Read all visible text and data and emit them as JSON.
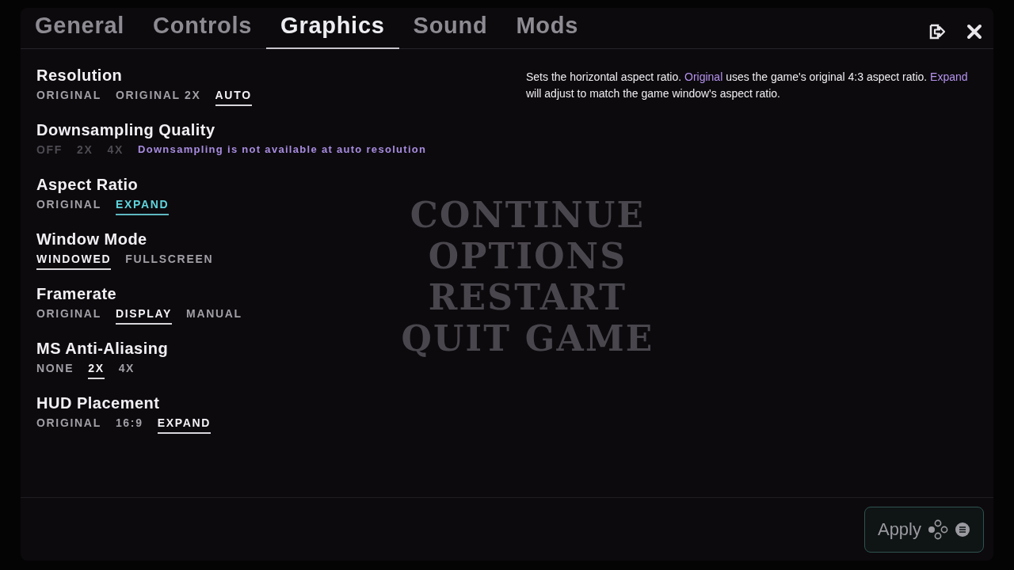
{
  "tabs": [
    {
      "label": "General",
      "selected": false
    },
    {
      "label": "Controls",
      "selected": false
    },
    {
      "label": "Graphics",
      "selected": true
    },
    {
      "label": "Sound",
      "selected": false
    },
    {
      "label": "Mods",
      "selected": false
    }
  ],
  "background_menu": [
    "CONTINUE",
    "OPTIONS",
    "RESTART",
    "QUIT GAME"
  ],
  "settings": [
    {
      "title": "Resolution",
      "disabled": false,
      "options": [
        {
          "label": "ORIGINAL",
          "selected": false,
          "highlighted": false
        },
        {
          "label": "ORIGINAL 2X",
          "selected": false,
          "highlighted": false
        },
        {
          "label": "AUTO",
          "selected": true,
          "highlighted": false
        }
      ]
    },
    {
      "title": "Downsampling Quality",
      "disabled": true,
      "note": "Downsampling is not available at auto resolution",
      "options": [
        {
          "label": "OFF",
          "selected": false,
          "highlighted": false
        },
        {
          "label": "2X",
          "selected": false,
          "highlighted": false
        },
        {
          "label": "4X",
          "selected": false,
          "highlighted": false
        }
      ]
    },
    {
      "title": "Aspect Ratio",
      "disabled": false,
      "options": [
        {
          "label": "ORIGINAL",
          "selected": false,
          "highlighted": false
        },
        {
          "label": "EXPAND",
          "selected": true,
          "highlighted": true
        }
      ]
    },
    {
      "title": "Window Mode",
      "disabled": false,
      "options": [
        {
          "label": "WINDOWED",
          "selected": true,
          "highlighted": false
        },
        {
          "label": "FULLSCREEN",
          "selected": false,
          "highlighted": false
        }
      ]
    },
    {
      "title": "Framerate",
      "disabled": false,
      "options": [
        {
          "label": "ORIGINAL",
          "selected": false,
          "highlighted": false
        },
        {
          "label": "DISPLAY",
          "selected": true,
          "highlighted": false
        },
        {
          "label": "MANUAL",
          "selected": false,
          "highlighted": false
        }
      ]
    },
    {
      "title": "MS Anti-Aliasing",
      "disabled": false,
      "options": [
        {
          "label": "NONE",
          "selected": false,
          "highlighted": false
        },
        {
          "label": "2X",
          "selected": true,
          "highlighted": false
        },
        {
          "label": "4X",
          "selected": false,
          "highlighted": false
        }
      ]
    },
    {
      "title": "HUD Placement",
      "disabled": false,
      "options": [
        {
          "label": "ORIGINAL",
          "selected": false,
          "highlighted": false
        },
        {
          "label": "16:9",
          "selected": false,
          "highlighted": false
        },
        {
          "label": "EXPAND",
          "selected": true,
          "highlighted": false
        }
      ]
    }
  ],
  "description": [
    {
      "text": "Sets the horizontal aspect ratio. ",
      "kind": "plain"
    },
    {
      "text": "Original",
      "kind": "highlight"
    },
    {
      "text": " uses the game's original 4:3 aspect ratio. ",
      "kind": "plain"
    },
    {
      "text": "Expand",
      "kind": "highlight"
    },
    {
      "text": " will adjust to match the game window's aspect ratio.",
      "kind": "plain"
    }
  ],
  "apply_button": {
    "label": "Apply"
  }
}
